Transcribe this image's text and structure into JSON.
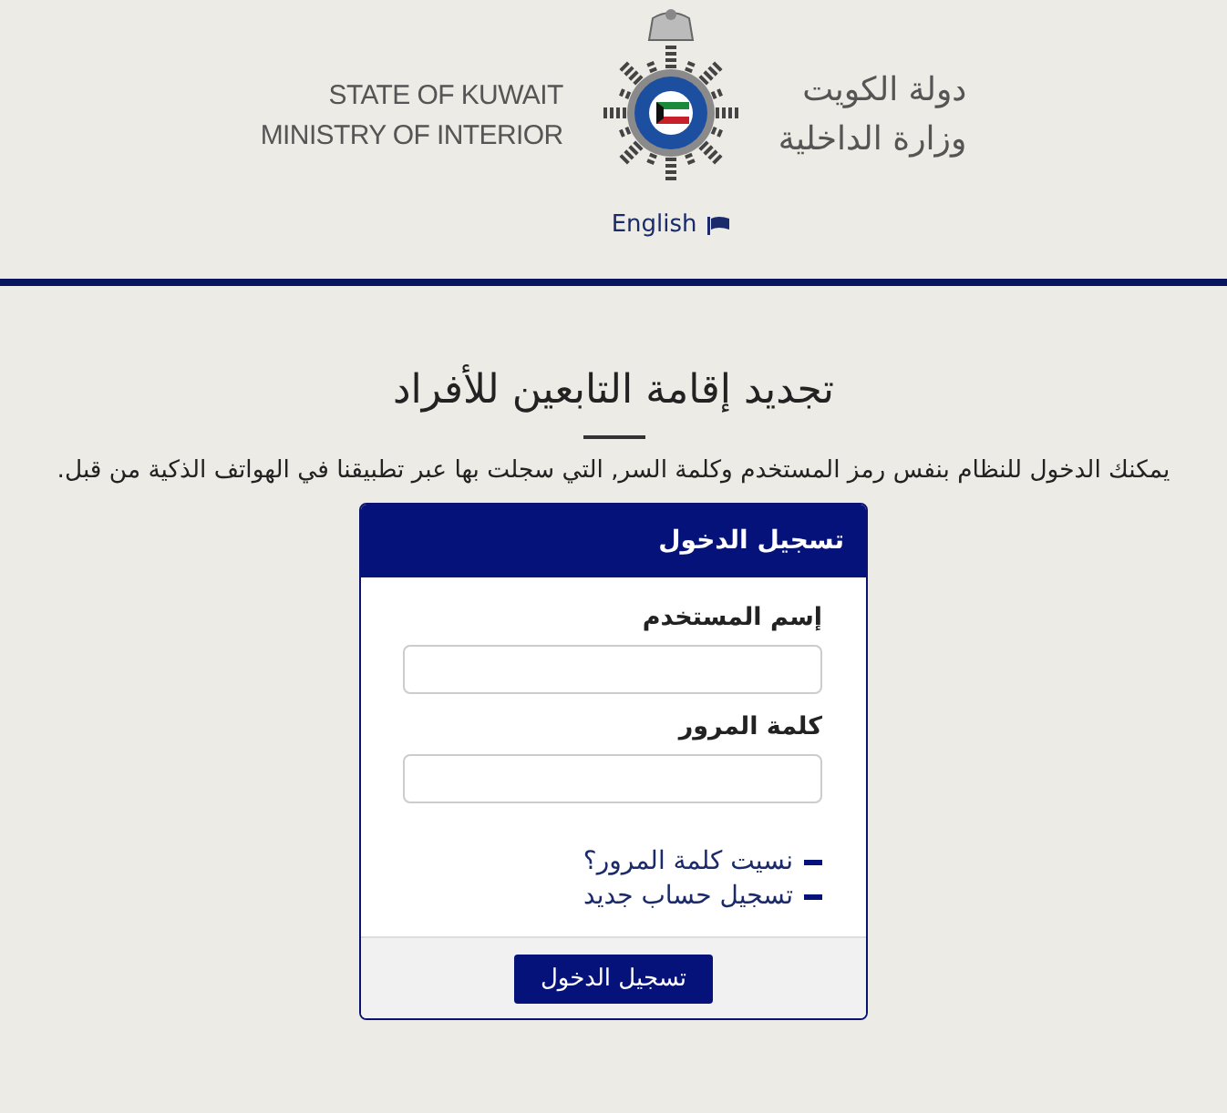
{
  "header": {
    "name_en": [
      "STATE OF KUWAIT",
      "MINISTRY OF INTERIOR"
    ],
    "name_ar": [
      "دولة الكويت",
      "وزارة الداخلية"
    ],
    "language_link": "English"
  },
  "page": {
    "title": "تجديد إقامة التابعين للأفراد",
    "intro": "يمكنك الدخول للنظام بنفس رمز المستخدم وكلمة السر, التي سجلت بها عبر تطبيقنا في الهواتف الذكية من قبل."
  },
  "login": {
    "heading": "تسجيل الدخول",
    "fields": [
      {
        "label": "إسم المستخدم"
      },
      {
        "label": "كلمة المرور"
      }
    ],
    "links": [
      "نسيت كلمة المرور؟",
      "تسجيل حساب جديد"
    ],
    "submit": "تسجيل الدخول"
  }
}
